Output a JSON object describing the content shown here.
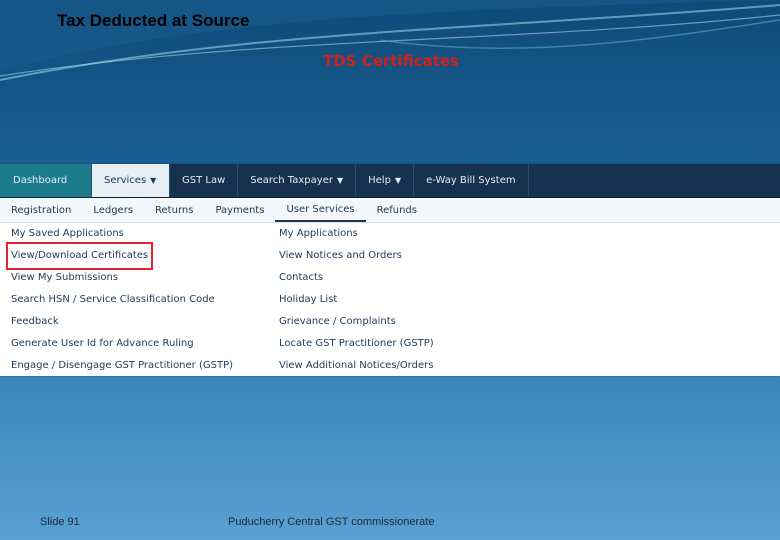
{
  "slide": {
    "title": "Tax Deducted at Source",
    "subtitle": "TDS Certificates",
    "footer_left": "Slide 91",
    "footer_center": "Puducherry Central GST commissionerate"
  },
  "navbar": {
    "items": [
      {
        "label": "Dashboard"
      },
      {
        "label": "Services"
      },
      {
        "label": "GST Law"
      },
      {
        "label": "Search Taxpayer"
      },
      {
        "label": "Help"
      },
      {
        "label": "e-Way Bill System"
      }
    ]
  },
  "subnav": {
    "items": [
      {
        "label": "Registration"
      },
      {
        "label": "Ledgers"
      },
      {
        "label": "Returns"
      },
      {
        "label": "Payments"
      },
      {
        "label": "User Services"
      },
      {
        "label": "Refunds"
      }
    ]
  },
  "menu": {
    "left": [
      "My Saved Applications",
      "View/Download Certificates",
      "View My Submissions",
      "Search HSN / Service Classification Code",
      "Feedback",
      "Generate User Id for Advance Ruling",
      "Engage / Disengage GST Practitioner (GSTP)"
    ],
    "right": [
      "My Applications",
      "View Notices and Orders",
      "Contacts",
      "Holiday List",
      "Grievance / Complaints",
      "Locate GST Practitioner (GSTP)",
      "View Additional Notices/Orders"
    ]
  },
  "colors": {
    "highlight_box": "#e3242b",
    "navbar_bg": "#16324f",
    "dashboard_bg": "#1c7c8c",
    "subtitle": "#d2201d"
  }
}
